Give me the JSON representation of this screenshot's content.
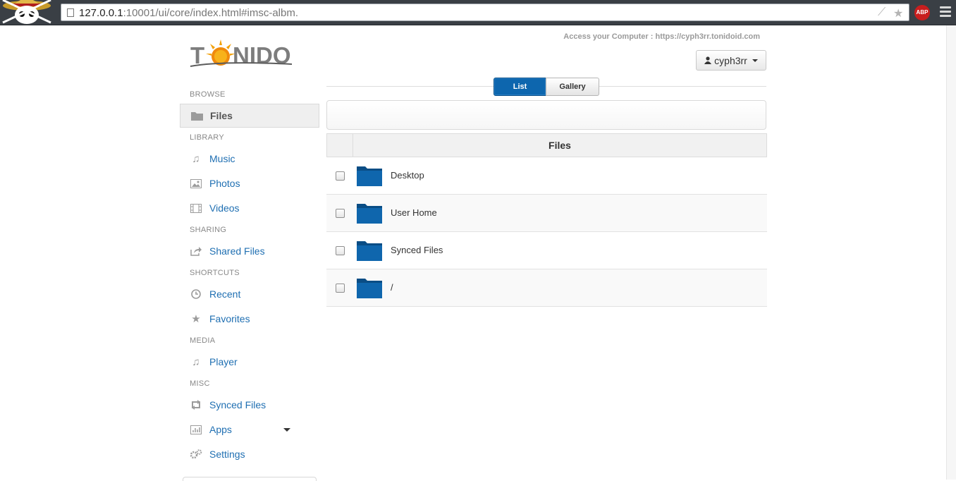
{
  "browser": {
    "url_host": "127.0.0.1",
    "url_rest": ":10001/ui/core/index.html#imsc-albm.",
    "extension_badge": "ABP"
  },
  "header": {
    "logo_text": "TONIDO",
    "access_text": "Access your Computer : https://cyph3rr.tonidoid.com",
    "user_label": "cyph3rr"
  },
  "sidebar": {
    "sections": [
      {
        "label": "BROWSE"
      },
      {
        "label": "LIBRARY"
      },
      {
        "label": "SHARING"
      },
      {
        "label": "SHORTCUTS"
      },
      {
        "label": "MEDIA"
      },
      {
        "label": "MISC"
      }
    ],
    "items": [
      {
        "label": "Files",
        "icon": "folder-icon",
        "active": true
      },
      {
        "label": "Music",
        "icon": "music-note-icon"
      },
      {
        "label": "Photos",
        "icon": "picture-icon"
      },
      {
        "label": "Videos",
        "icon": "film-icon"
      },
      {
        "label": "Shared Files",
        "icon": "share-icon"
      },
      {
        "label": "Recent",
        "icon": "clock-icon"
      },
      {
        "label": "Favorites",
        "icon": "star-icon"
      },
      {
        "label": "Player",
        "icon": "music-note-icon"
      },
      {
        "label": "Synced Files",
        "icon": "sync-icon"
      },
      {
        "label": "Apps",
        "icon": "bar-chart-icon"
      },
      {
        "label": "Settings",
        "icon": "gears-icon"
      }
    ]
  },
  "view_toggle": {
    "list_label": "List",
    "gallery_label": "Gallery",
    "selected": "List"
  },
  "table": {
    "header": "Files",
    "rows": [
      {
        "name": "Desktop"
      },
      {
        "name": "User Home"
      },
      {
        "name": "Synced Files"
      },
      {
        "name": "/"
      }
    ]
  },
  "colors": {
    "accent": "#0d66ae",
    "link": "#1f6fb2",
    "folder": "#0a5c9e"
  }
}
